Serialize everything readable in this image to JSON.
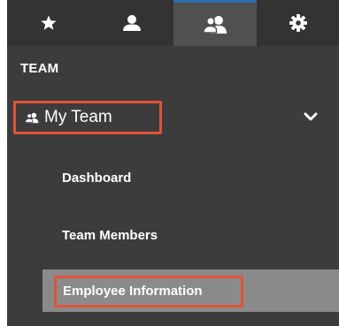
{
  "tabs": [
    {
      "icon": "star-icon",
      "active": false
    },
    {
      "icon": "user-icon",
      "active": false
    },
    {
      "icon": "team-icon",
      "active": true
    },
    {
      "icon": "gear-icon",
      "active": false
    }
  ],
  "section": {
    "heading": "TEAM"
  },
  "group": {
    "label": "My Team",
    "icon": "team-icon",
    "expanded": true
  },
  "items": [
    {
      "label": "Dashboard",
      "selected": false
    },
    {
      "label": "Team Members",
      "selected": false
    },
    {
      "label": "Employee Information",
      "selected": true
    }
  ],
  "colors": {
    "panel": "#3c3c3c",
    "tabbar": "#333333",
    "active_tab": "#505050",
    "selected_item": "#8a8a8a",
    "highlight": "#e0523a",
    "text": "#ffffff"
  }
}
